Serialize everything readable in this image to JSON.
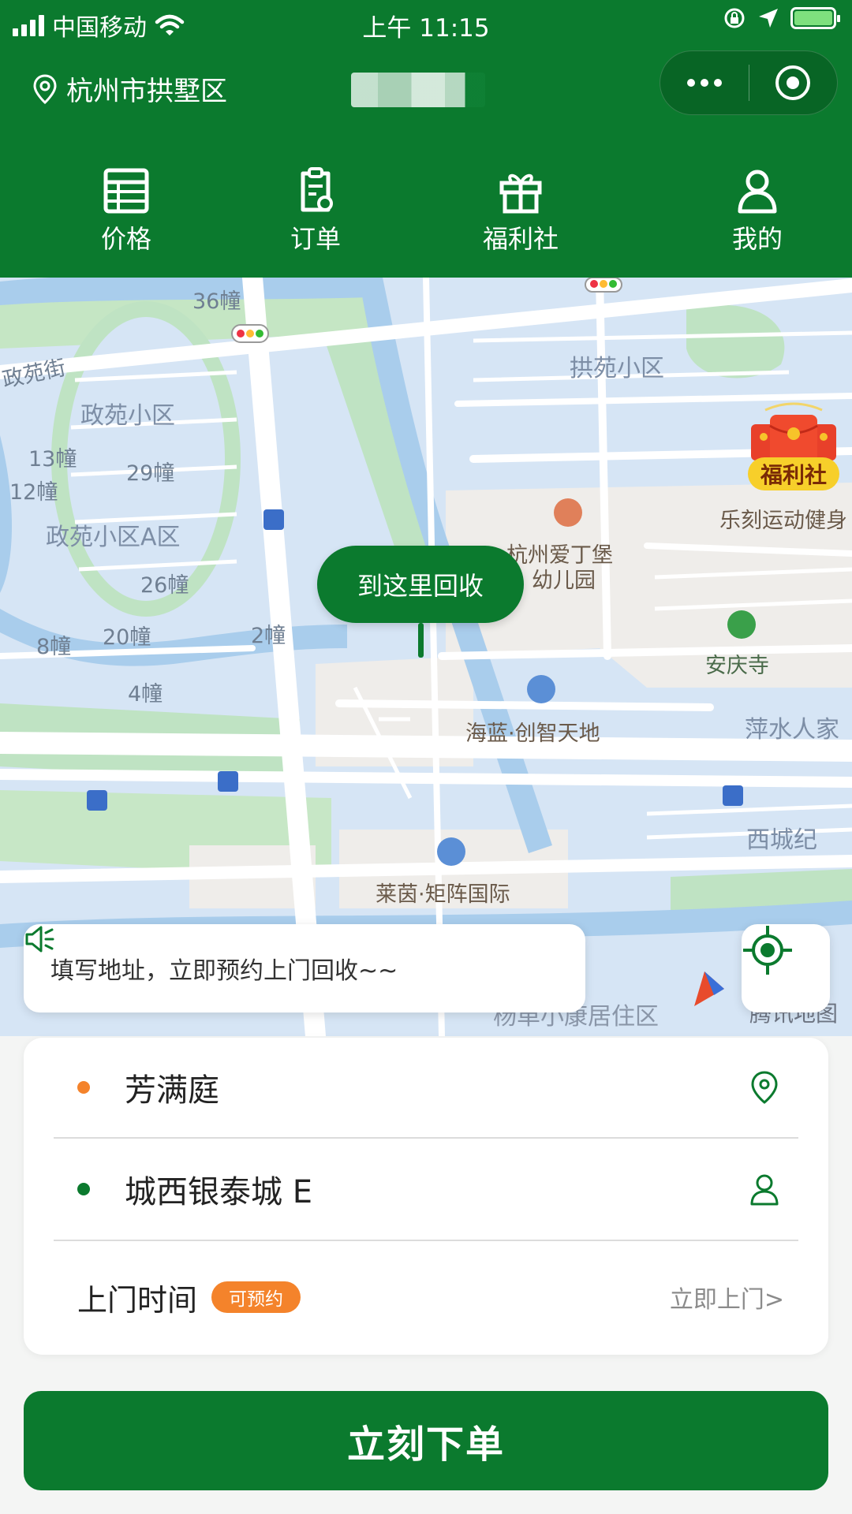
{
  "status_bar": {
    "carrier": "中国移动",
    "time": "上午 11:15"
  },
  "header": {
    "location": "杭州市拱墅区"
  },
  "nav": {
    "items": [
      {
        "label": "价格",
        "icon": "price-list-icon"
      },
      {
        "label": "订单",
        "icon": "order-clipboard-icon"
      },
      {
        "label": "福利社",
        "icon": "gift-icon"
      },
      {
        "label": "我的",
        "icon": "profile-icon"
      }
    ]
  },
  "map": {
    "callout": "到这里回收",
    "welfare_badge": "福利社",
    "notice": "填写地址，立即预约上门回收~~",
    "attribution": "腾讯地图",
    "labels": {
      "b36": "36幢",
      "zhengyuan_street": "政苑街",
      "zhengyuan": "政苑小区",
      "b13": "13幢",
      "b29": "29幢",
      "b12": "12幢",
      "zhengyuan_a": "政苑小区A区",
      "b26": "26幢",
      "b20": "20幢",
      "b8": "8幢",
      "b2": "2幢",
      "b4": "4幢",
      "gongyuan": "拱苑小区",
      "fitness": "乐刻运动健身",
      "kindergarten1": "杭州爱丁堡",
      "kindergarten2": "幼儿园",
      "anqing": "安庆寺",
      "hailan": "海蓝·创智天地",
      "pingshui": "萍水人家",
      "xicheng": "西城纪",
      "laiyin": "莱茵·矩阵国际",
      "street_bottom": "杨单小康居住区"
    }
  },
  "form": {
    "pickup_name": "芳满庭",
    "contact_name": "城西银泰城 E",
    "time_label": "上门时间",
    "time_badge": "可预约",
    "time_value": "立即上门>"
  },
  "submit": {
    "label": "立刻下单"
  },
  "colors": {
    "brand_green": "#0b7a2e",
    "accent_orange": "#f4832b",
    "badge_yellow": "#f7cf2a"
  }
}
